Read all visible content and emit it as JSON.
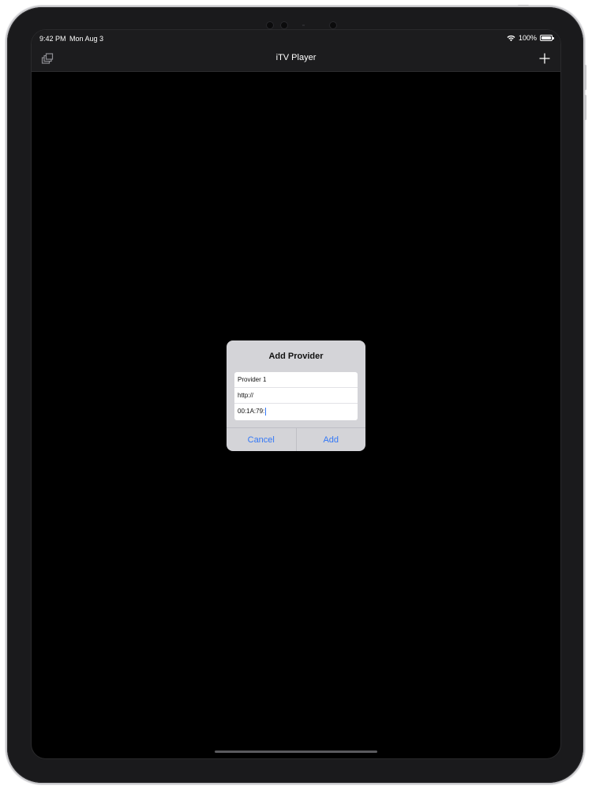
{
  "status_bar": {
    "time": "9:42 PM",
    "date": "Mon Aug 3",
    "battery": "100%"
  },
  "nav": {
    "title": "iTV Player",
    "left_icon": "stack-icon",
    "right_icon": "plus-icon"
  },
  "alert": {
    "title": "Add Provider",
    "fields": {
      "name": "Provider 1",
      "url": "http://",
      "mac": "00:1A:79:"
    },
    "cancel_label": "Cancel",
    "add_label": "Add"
  },
  "colors": {
    "accent": "#3478f6",
    "screen_bg": "#000000",
    "bar_bg": "#1c1c1e",
    "alert_bg": "#d4d4d8"
  }
}
